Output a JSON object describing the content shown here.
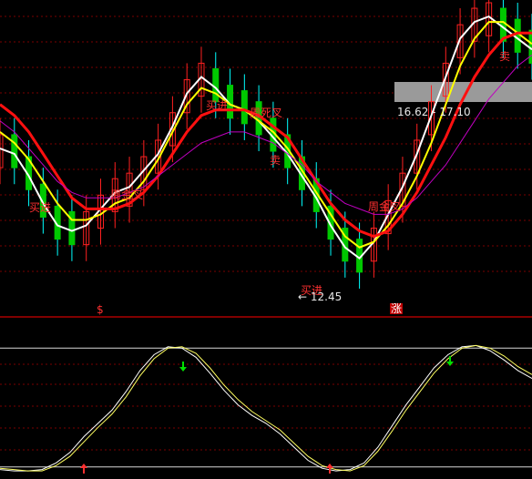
{
  "colors": {
    "background": "#000000",
    "grid": "#7a0000",
    "separator": "#ff0000",
    "candle_up": "#ff2020",
    "candle_down": "#00ffff",
    "candle_down_body": "#00c800",
    "ma_white": "#ffffff",
    "ma_yellow": "#ffff00",
    "ma_red": "#ff1010",
    "ma_magenta": "#c000c0",
    "osc_white": "#ffffff",
    "osc_yellow": "#ffff60",
    "signal_text": "#ff3030",
    "arrow_down": "#00e000",
    "arrow_up": "#ff3030"
  },
  "annotations": [
    {
      "text": "买进",
      "color": "red"
    },
    {
      "text": "周金叉",
      "color": "red"
    },
    {
      "text": "买进",
      "color": "red"
    },
    {
      "text": "周死叉",
      "color": "red"
    },
    {
      "text": "卖",
      "color": "red"
    },
    {
      "text": "买进",
      "color": "red"
    },
    {
      "text": "周金叉",
      "color": "red"
    },
    {
      "text": "卖",
      "color": "red"
    }
  ],
  "price_labels": {
    "low": "← 12.45",
    "high_range": "16.62 - 17.10"
  },
  "markers": {
    "left": "$",
    "right": "涨"
  },
  "chart_data": [
    {
      "type": "candlestick",
      "title": "",
      "ylim": [
        11.9,
        17.3
      ],
      "low_marker": 12.45,
      "high_range": [
        16.62,
        17.1
      ],
      "grid": true,
      "series": [
        {
          "name": "",
          "values": [
            14.6,
            14.5,
            14.1,
            13.6,
            13.2,
            13.1,
            13.2,
            13.5,
            13.8,
            13.9,
            14.2,
            14.5,
            15.0,
            15.6,
            15.9,
            15.7,
            15.4,
            15.3,
            15.1,
            14.8,
            14.5,
            14.1,
            13.7,
            13.2,
            12.8,
            12.6,
            12.9,
            13.4,
            13.9,
            14.5,
            15.2,
            15.9,
            16.6,
            16.9,
            17.0,
            16.8,
            16.6,
            16.4
          ]
        },
        {
          "name": "",
          "values": [
            14.9,
            14.7,
            14.4,
            14.0,
            13.6,
            13.3,
            13.3,
            13.4,
            13.6,
            13.7,
            14.0,
            14.4,
            14.9,
            15.4,
            15.7,
            15.6,
            15.4,
            15.3,
            15.1,
            14.9,
            14.6,
            14.2,
            13.8,
            13.4,
            13.0,
            12.8,
            12.9,
            13.2,
            13.6,
            14.1,
            14.7,
            15.4,
            16.1,
            16.6,
            16.9,
            16.9,
            16.7,
            16.5
          ]
        },
        {
          "name": "",
          "values": [
            15.4,
            15.2,
            14.9,
            14.5,
            14.1,
            13.7,
            13.5,
            13.5,
            13.5,
            13.6,
            13.8,
            14.1,
            14.5,
            14.9,
            15.2,
            15.3,
            15.3,
            15.3,
            15.2,
            15.0,
            14.8,
            14.4,
            14.0,
            13.6,
            13.3,
            13.1,
            13.0,
            13.1,
            13.4,
            13.8,
            14.3,
            14.8,
            15.4,
            15.9,
            16.3,
            16.6,
            16.7,
            16.7
          ]
        },
        {
          "name": "",
          "values": [
            15.1,
            14.9,
            14.6,
            14.3,
            14.0,
            13.8,
            13.7,
            13.7,
            13.7,
            13.8,
            13.9,
            14.1,
            14.3,
            14.5,
            14.7,
            14.8,
            14.9,
            14.9,
            14.8,
            14.7,
            14.5,
            14.3,
            14.0,
            13.8,
            13.6,
            13.5,
            13.4,
            13.4,
            13.5,
            13.7,
            14.0,
            14.3,
            14.7,
            15.1,
            15.5,
            15.8,
            16.1,
            16.3
          ]
        }
      ]
    },
    {
      "type": "line",
      "title": "",
      "ylim": [
        0,
        100
      ],
      "reference_lines": [
        95,
        5
      ],
      "series": [
        {
          "name": "",
          "values": [
            3,
            2,
            2,
            3,
            8,
            16,
            28,
            38,
            48,
            62,
            78,
            90,
            96,
            95,
            88,
            76,
            63,
            52,
            44,
            38,
            30,
            20,
            10,
            4,
            2,
            3,
            8,
            20,
            36,
            52,
            66,
            80,
            90,
            96,
            97,
            93,
            86,
            78,
            72
          ]
        },
        {
          "name": "",
          "values": [
            4,
            3,
            2,
            2,
            6,
            13,
            24,
            35,
            45,
            58,
            74,
            87,
            95,
            96,
            91,
            80,
            67,
            56,
            47,
            40,
            33,
            23,
            13,
            6,
            3,
            2,
            6,
            17,
            32,
            48,
            62,
            76,
            87,
            95,
            97,
            95,
            89,
            81,
            75
          ]
        }
      ]
    }
  ]
}
